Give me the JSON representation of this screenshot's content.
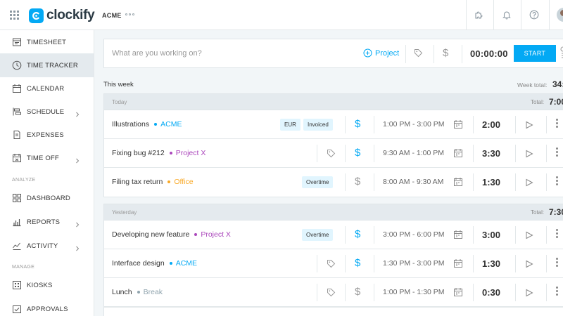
{
  "header": {
    "logo_text": "clockify",
    "workspace": "ACME"
  },
  "sidebar": {
    "items": [
      {
        "label": "TIMESHEET"
      },
      {
        "label": "TIME TRACKER"
      },
      {
        "label": "CALENDAR"
      },
      {
        "label": "SCHEDULE"
      },
      {
        "label": "EXPENSES"
      },
      {
        "label": "TIME OFF"
      },
      {
        "label": "DASHBOARD"
      },
      {
        "label": "REPORTS"
      },
      {
        "label": "ACTIVITY"
      },
      {
        "label": "KIOSKS"
      },
      {
        "label": "APPROVALS"
      }
    ],
    "sections": {
      "analyze": "ANALYZE",
      "manage": "MANAGE"
    }
  },
  "tracker": {
    "placeholder": "What are you working on?",
    "project_label": "Project",
    "time": "00:00:00",
    "start_label": "START"
  },
  "week": {
    "label": "This week",
    "total_label": "Week total:",
    "total_value": "34:"
  },
  "groups": [
    {
      "label": "Today",
      "total_label": "Total:",
      "total_value": "7:00",
      "rows": [
        {
          "desc": "Illustrations",
          "project": "ACME",
          "badges": [
            "EUR",
            "Invoiced"
          ],
          "range": "1:00 PM - 3:00 PM",
          "duration": "2:00"
        },
        {
          "desc": "Fixing bug #212",
          "project": "Project X",
          "badges": [],
          "range": "9:30 AM - 1:00 PM",
          "duration": "3:30"
        },
        {
          "desc": "Filing tax return",
          "project": "Office",
          "badges": [
            "Overtime"
          ],
          "range": "8:00 AM - 9:30 AM",
          "duration": "1:30"
        }
      ]
    },
    {
      "label": "Yesterday",
      "total_label": "Total:",
      "total_value": "7:30",
      "rows": [
        {
          "desc": "Developing new feature",
          "project": "Project X",
          "badges": [
            "Overtime"
          ],
          "range": "3:00 PM - 6:00 PM",
          "duration": "3:00"
        },
        {
          "desc": "Interface design",
          "project": "ACME",
          "badges": [],
          "range": "1:30 PM - 3:00 PM",
          "duration": "1:30"
        },
        {
          "desc": "Lunch",
          "project": "Break",
          "badges": [],
          "range": "1:00 PM - 1:30 PM",
          "duration": "0:30"
        }
      ]
    }
  ],
  "colors": {
    "accent": "#03a9f4",
    "project_acme": "#03a9f4",
    "project_x": "#ab47bc",
    "project_office": "#f9a825",
    "project_break": "#90a4ae",
    "billable": "#03a9f4",
    "non_billable": "#999999"
  }
}
